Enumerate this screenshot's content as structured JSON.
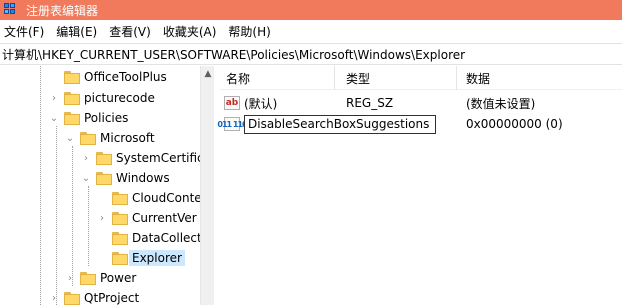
{
  "window": {
    "title": "注册表编辑器"
  },
  "menu": {
    "items": [
      "文件(F)",
      "编辑(E)",
      "查看(V)",
      "收藏夹(A)",
      "帮助(H)"
    ]
  },
  "address": {
    "path": "计算机\\HKEY_CURRENT_USER\\SOFTWARE\\Policies\\Microsoft\\Windows\\Explorer"
  },
  "tree": {
    "items": [
      {
        "label": "OfficeToolPlus",
        "expander": ""
      },
      {
        "label": "picturecode",
        "expander": "›"
      },
      {
        "label": "Policies",
        "expander": "⌄"
      },
      {
        "label": "Microsoft",
        "expander": "⌄"
      },
      {
        "label": "SystemCertific",
        "expander": "›"
      },
      {
        "label": "Windows",
        "expander": "⌄"
      },
      {
        "label": "CloudConte",
        "expander": ""
      },
      {
        "label": "CurrentVer",
        "expander": "›"
      },
      {
        "label": "DataCollect",
        "expander": ""
      },
      {
        "label": "Explorer",
        "expander": "",
        "selected": true
      },
      {
        "label": "Power",
        "expander": "›"
      },
      {
        "label": "QtProject",
        "expander": "›"
      }
    ]
  },
  "list": {
    "columns": [
      "名称",
      "类型",
      "数据"
    ],
    "rows": [
      {
        "name": "(默认)",
        "type": "REG_SZ",
        "data": "(数值未设置)",
        "icon": "ab"
      },
      {
        "name": "DisableSearchBoxSuggestions",
        "type": "",
        "data": "0x00000000 (0)",
        "icon": "011\n110"
      }
    ]
  },
  "icons": {
    "string_value": "string-value-icon",
    "dword_value": "dword-value-icon",
    "folder": "folder-icon",
    "app": "registry-editor-icon"
  },
  "colors": {
    "titlebar": "#f07a5b",
    "selection": "#cce8ff",
    "folder": "#ffd86a"
  }
}
